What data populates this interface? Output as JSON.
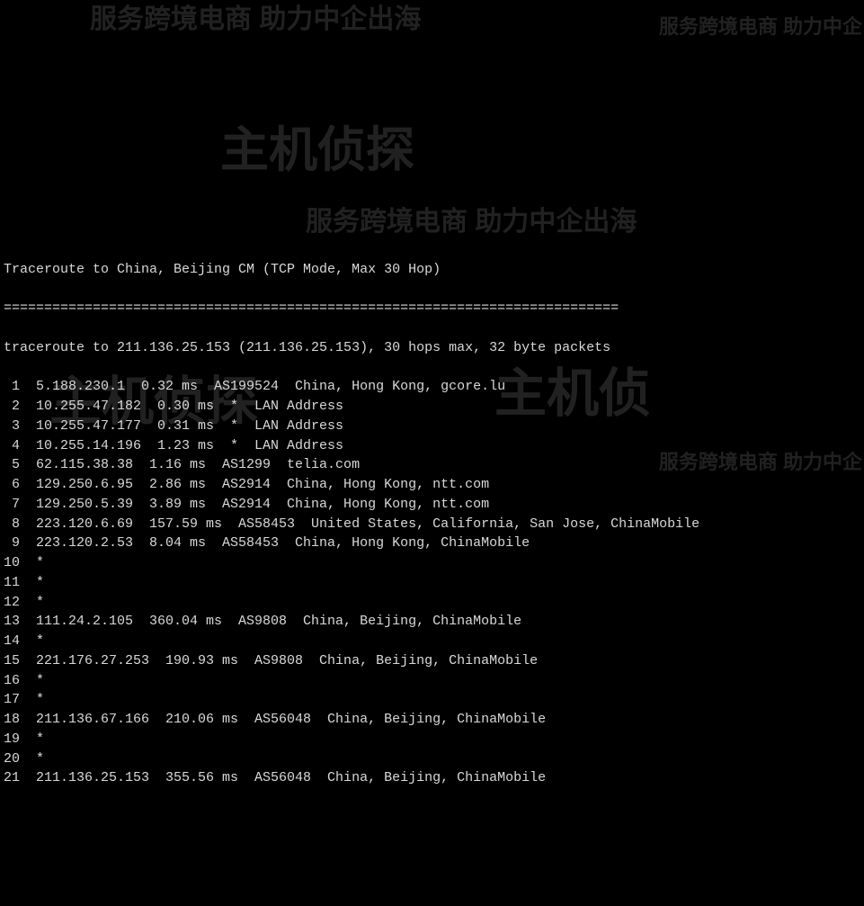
{
  "title": "Traceroute to China, Beijing CM (TCP Mode, Max 30 Hop)",
  "separator": "============================================================================",
  "summary": "traceroute to 211.136.25.153 (211.136.25.153), 30 hops max, 32 byte packets",
  "hops": [
    {
      "n": " 1",
      "ip": "5.188.230.1",
      "ms": "0.32 ms",
      "asn": "AS199524",
      "loc": "China, Hong Kong, gcore.lu"
    },
    {
      "n": " 2",
      "ip": "10.255.47.182",
      "ms": "0.30 ms",
      "asn": "*",
      "loc": "LAN Address"
    },
    {
      "n": " 3",
      "ip": "10.255.47.177",
      "ms": "0.31 ms",
      "asn": "*",
      "loc": "LAN Address"
    },
    {
      "n": " 4",
      "ip": "10.255.14.196",
      "ms": "1.23 ms",
      "asn": "*",
      "loc": "LAN Address"
    },
    {
      "n": " 5",
      "ip": "62.115.38.38",
      "ms": "1.16 ms",
      "asn": "AS1299",
      "loc": "telia.com"
    },
    {
      "n": " 6",
      "ip": "129.250.6.95",
      "ms": "2.86 ms",
      "asn": "AS2914",
      "loc": "China, Hong Kong, ntt.com"
    },
    {
      "n": " 7",
      "ip": "129.250.5.39",
      "ms": "3.89 ms",
      "asn": "AS2914",
      "loc": "China, Hong Kong, ntt.com"
    },
    {
      "n": " 8",
      "ip": "223.120.6.69",
      "ms": "157.59 ms",
      "asn": "AS58453",
      "loc": "United States, California, San Jose, ChinaMobile"
    },
    {
      "n": " 9",
      "ip": "223.120.2.53",
      "ms": "8.04 ms",
      "asn": "AS58453",
      "loc": "China, Hong Kong, ChinaMobile"
    },
    {
      "n": "10",
      "ip": "*",
      "ms": "",
      "asn": "",
      "loc": ""
    },
    {
      "n": "11",
      "ip": "*",
      "ms": "",
      "asn": "",
      "loc": ""
    },
    {
      "n": "12",
      "ip": "*",
      "ms": "",
      "asn": "",
      "loc": ""
    },
    {
      "n": "13",
      "ip": "111.24.2.105",
      "ms": "360.04 ms",
      "asn": "AS9808",
      "loc": "China, Beijing, ChinaMobile"
    },
    {
      "n": "14",
      "ip": "*",
      "ms": "",
      "asn": "",
      "loc": ""
    },
    {
      "n": "15",
      "ip": "221.176.27.253",
      "ms": "190.93 ms",
      "asn": "AS9808",
      "loc": "China, Beijing, ChinaMobile"
    },
    {
      "n": "16",
      "ip": "*",
      "ms": "",
      "asn": "",
      "loc": ""
    },
    {
      "n": "17",
      "ip": "*",
      "ms": "",
      "asn": "",
      "loc": ""
    },
    {
      "n": "18",
      "ip": "211.136.67.166",
      "ms": "210.06 ms",
      "asn": "AS56048",
      "loc": "China, Beijing, ChinaMobile"
    },
    {
      "n": "19",
      "ip": "*",
      "ms": "",
      "asn": "",
      "loc": ""
    },
    {
      "n": "20",
      "ip": "*",
      "ms": "",
      "asn": "",
      "loc": ""
    },
    {
      "n": "21",
      "ip": "211.136.25.153",
      "ms": "355.56 ms",
      "asn": "AS56048",
      "loc": "China, Beijing, ChinaMobile"
    }
  ],
  "watermarks": {
    "wm1": "服务跨境电商 助力中企出海",
    "wm2": "主机侦探",
    "wm3": "服务跨境电商 助力中企出海",
    "wm4": "服务跨境电商 助力中企",
    "wm5": "主机侦探",
    "wm6": "主机侦",
    "wm7": "服务跨境电商 助力中企"
  }
}
